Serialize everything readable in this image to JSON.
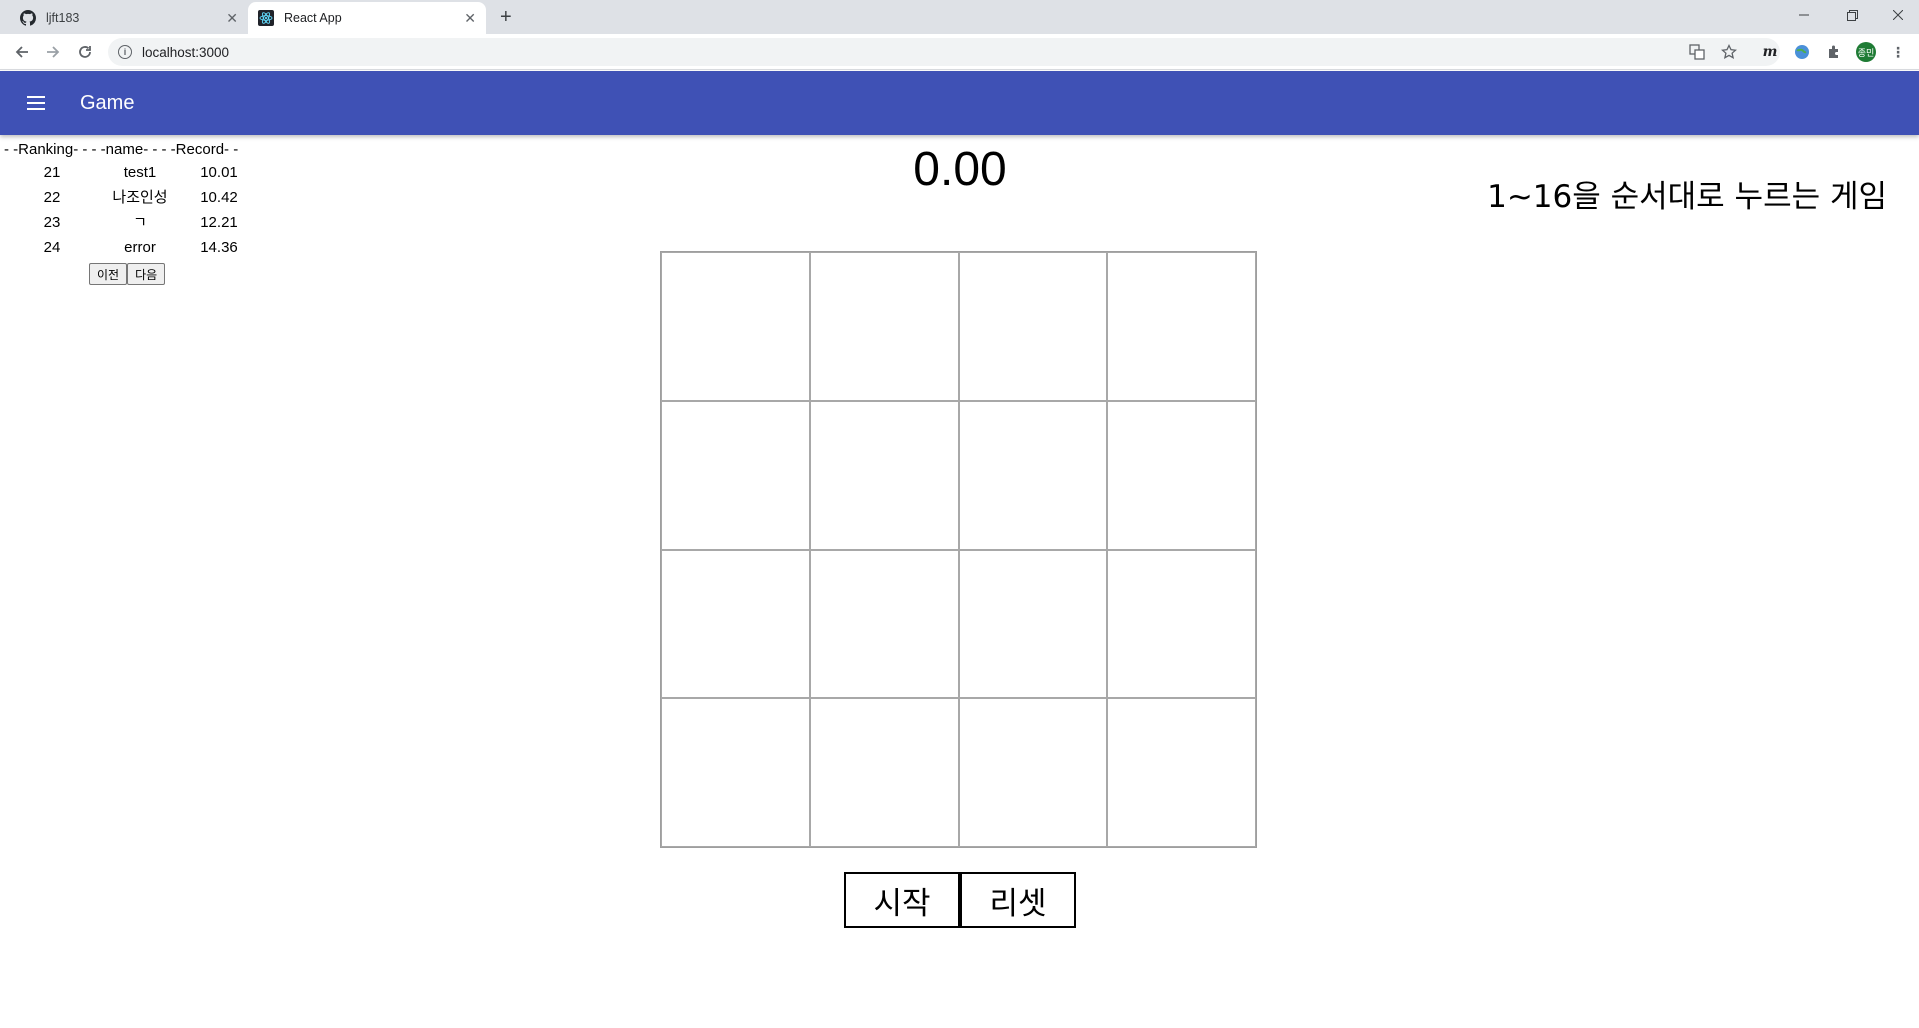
{
  "browser": {
    "tabs": [
      {
        "title": "ljft183",
        "icon": "github-icon",
        "active": false
      },
      {
        "title": "React App",
        "icon": "react-icon",
        "active": true
      }
    ],
    "url": "localhost:3000",
    "profile_initials": "종민"
  },
  "appbar": {
    "title": "Game",
    "color": "#3f51b5"
  },
  "ranking": {
    "header": "- -Ranking- - - -name- - - -Record- -",
    "rows": [
      {
        "rank": "21",
        "name": "test1",
        "record": "10.01"
      },
      {
        "rank": "22",
        "name": "나조인성",
        "record": "10.42"
      },
      {
        "rank": "23",
        "name": "ㄱ",
        "record": "12.21"
      },
      {
        "rank": "24",
        "name": "error",
        "record": "14.36"
      }
    ],
    "prev_label": "이전",
    "next_label": "다음"
  },
  "game": {
    "timer": "0.00",
    "description": "1~16을 순서대로 누르는 게임",
    "cells": [
      "",
      "",
      "",
      "",
      "",
      "",
      "",
      "",
      "",
      "",
      "",
      "",
      "",
      "",
      "",
      ""
    ],
    "start_label": "시작",
    "reset_label": "리셋"
  }
}
